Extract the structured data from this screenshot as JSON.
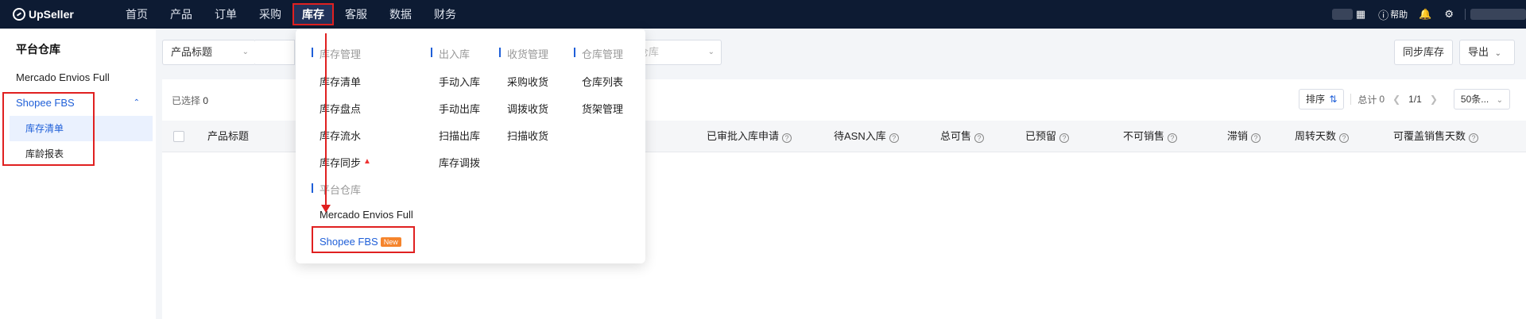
{
  "topbar": {
    "brand": "UpSeller",
    "nav": [
      "首页",
      "产品",
      "订单",
      "采购",
      "库存",
      "客服",
      "数据",
      "财务"
    ],
    "active": "库存",
    "help_label": "帮助"
  },
  "sidebar": {
    "title": "平台仓库",
    "items": [
      {
        "label": "Mercado Envios Full"
      },
      {
        "label": "Shopee FBS"
      }
    ],
    "sub_items": [
      {
        "label": "库存清单"
      },
      {
        "label": "库龄报表"
      }
    ]
  },
  "filters": {
    "product_title_select": "产品标题",
    "warehouse_placeholder": "仓库",
    "sync_button": "同步库存",
    "export_button": "导出"
  },
  "toolbar": {
    "selected_label": "已选择",
    "selected_count": "0",
    "sort_label": "排序",
    "total_label": "总计",
    "total_count": "0",
    "page_indicator": "1/1",
    "page_size": "50条..."
  },
  "table": {
    "columns": [
      {
        "label": "产品标题",
        "help": false
      },
      {
        "label": "已审批入库申请",
        "help": true
      },
      {
        "label": "待ASN入库",
        "help": true
      },
      {
        "label": "总可售",
        "help": true
      },
      {
        "label": "已预留",
        "help": true
      },
      {
        "label": "不可销售",
        "help": true
      },
      {
        "label": "滞销",
        "help": true
      },
      {
        "label": "周转天数",
        "help": true
      },
      {
        "label": "可覆盖销售天数",
        "help": true
      }
    ]
  },
  "dropdown": {
    "groups": [
      {
        "title": "库存管理",
        "items": [
          "库存清单",
          "库存盘点",
          "库存流水",
          "库存同步"
        ]
      },
      {
        "title": "出入库",
        "items": [
          "手动入库",
          "手动出库",
          "扫描出库",
          "库存调拨"
        ]
      },
      {
        "title": "收货管理",
        "items": [
          "采购收货",
          "调拨收货",
          "扫描收货"
        ]
      },
      {
        "title": "仓库管理",
        "items": [
          "仓库列表",
          "货架管理"
        ]
      },
      {
        "title": "平台仓库",
        "items": [
          "Mercado Envios Full",
          "Shopee FBS"
        ]
      }
    ],
    "new_tag": "New"
  },
  "colors": {
    "topbar_bg": "#0d1b33",
    "accent_blue": "#1f5fd8",
    "annotation_red": "#e02020",
    "new_tag_orange": "#f5842c"
  }
}
